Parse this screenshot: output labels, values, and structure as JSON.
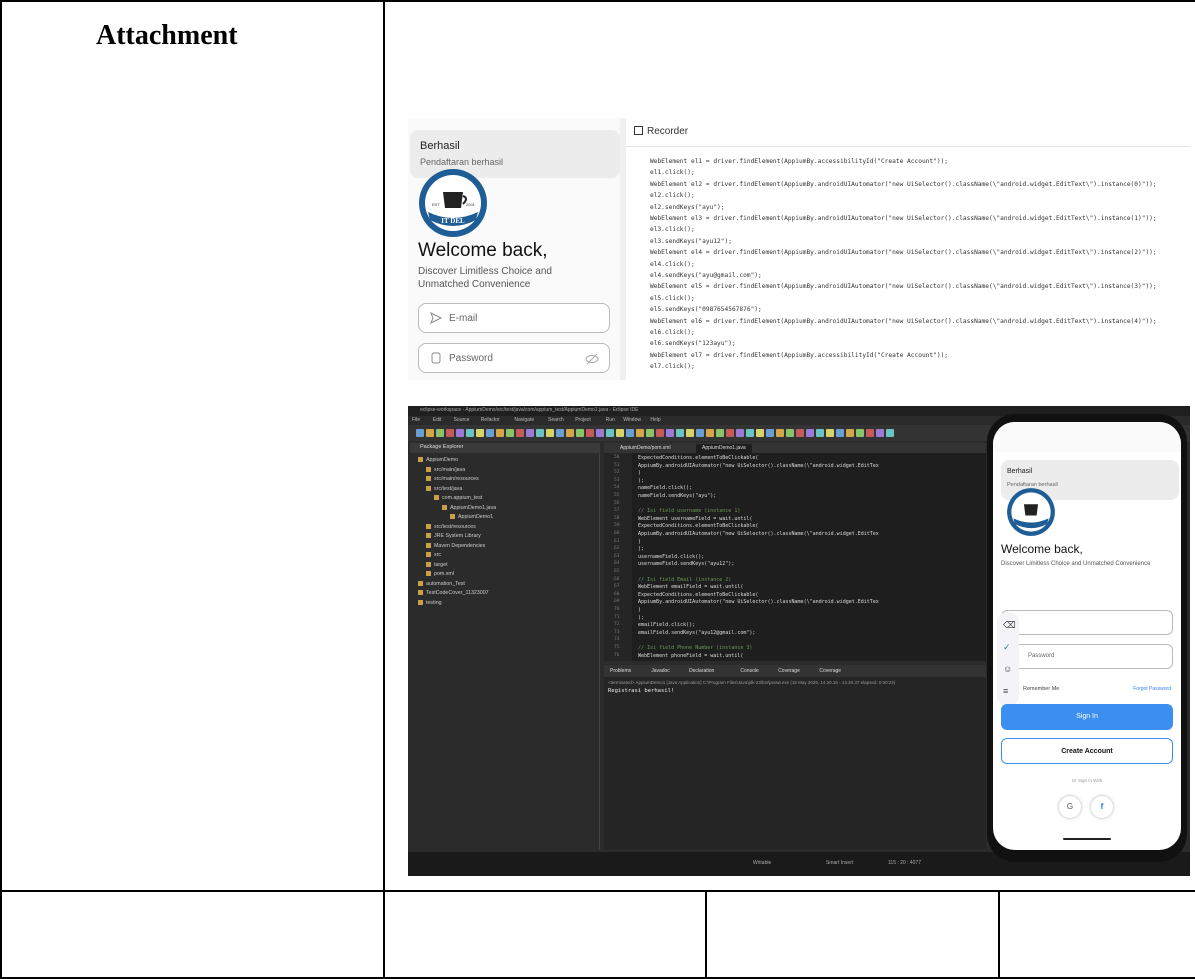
{
  "section": {
    "heading": "Attachment"
  },
  "recorder_shot": {
    "toast": {
      "title": "Berhasil",
      "message": "Pendaftaran berhasil"
    },
    "logo": {
      "left_text": "EST",
      "right_text": "2001",
      "band_text": "IT DEL"
    },
    "welcome": "Welcome back,",
    "subtitle": "Discover Limitless Choice and Unmatched Convenience",
    "email_placeholder": "E-mail",
    "password_placeholder": "Password",
    "recorder_title": "Recorder",
    "code_lines": [
      "WebElement el1 = driver.findElement(AppiumBy.accessibilityId(\"Create Account\"));",
      "el1.click();",
      "WebElement el2 = driver.findElement(AppiumBy.androidUIAutomator(\"new UiSelector().className(\\\"android.widget.EditText\\\").instance(0)\"));",
      "el2.click();",
      "el2.sendKeys(\"ayu\");",
      "WebElement el3 = driver.findElement(AppiumBy.androidUIAutomator(\"new UiSelector().className(\\\"android.widget.EditText\\\").instance(1)\"));",
      "el3.click();",
      "el3.sendKeys(\"ayu12\");",
      "WebElement el4 = driver.findElement(AppiumBy.androidUIAutomator(\"new UiSelector().className(\\\"android.widget.EditText\\\").instance(2)\"));",
      "el4.click();",
      "el4.sendKeys(\"ayu@gmail.com\");",
      "WebElement el5 = driver.findElement(AppiumBy.androidUIAutomator(\"new UiSelector().className(\\\"android.widget.EditText\\\").instance(3)\"));",
      "el5.click();",
      "el5.sendKeys(\"0987654567876\");",
      "WebElement el6 = driver.findElement(AppiumBy.androidUIAutomator(\"new UiSelector().className(\\\"android.widget.EditText\\\").instance(4)\"));",
      "el6.click();",
      "el6.sendKeys(\"123ayu\");",
      "WebElement el7 = driver.findElement(AppiumBy.accessibilityId(\"Create Account\"));",
      "el7.click();"
    ]
  },
  "eclipse_shot": {
    "window_title": "eclipse-workspace - AppiumDemo/src/test/java/com/appium_test/AppiumDemo1.java - Eclipse IDE",
    "menu": [
      "File",
      "Edit",
      "Source",
      "Refactor",
      "Navigate",
      "Search",
      "Project",
      "Run",
      "Window",
      "Help"
    ],
    "package_explorer_title": "Package Explorer",
    "tree": [
      "AppiumDemo",
      "src/main/java",
      "src/main/resources",
      "src/test/java",
      "com.appium_test",
      "AppiumDemo1.java",
      "AppiumDemo1",
      "src/test/resources",
      "JRE System Library",
      "Maven Dependencies",
      "src",
      "target",
      "pom.xml",
      "automation_Test",
      "TestCodeCover_11323007",
      "testing"
    ],
    "editor_tabs": [
      "AppiumDemo/pom.xml",
      "AppiumDemo1.java"
    ],
    "line_numbers": [
      "50",
      "51",
      "52",
      "53",
      "54",
      "55",
      "56",
      "57",
      "58",
      "59",
      "60",
      "61",
      "62",
      "63",
      "64",
      "65",
      "66",
      "67",
      "68",
      "69",
      "70",
      "71",
      "72",
      "73",
      "74",
      "75",
      "76"
    ],
    "code": [
      "ExpectedConditions.elementToBeClickable(",
      "    AppiumBy.androidUIAutomator(\"new UiSelector().className(\\\"android.widget.EditTex",
      ")",
      ");",
      "nameField.click();",
      "nameField.sendKeys(\"ayu\");",
      "",
      "// Isi field username (instance 1)",
      "WebElement usernameField = wait.until(",
      "    ExpectedConditions.elementToBeClickable(",
      "        AppiumBy.androidUIAutomator(\"new UiSelector().className(\\\"android.widget.EditTex",
      "    )",
      ");",
      "usernameField.click();",
      "usernameField.sendKeys(\"ayu12\");",
      "",
      "// Isi field Email (instance 2)",
      "WebElement emailField = wait.until(",
      "    ExpectedConditions.elementToBeClickable(",
      "        AppiumBy.androidUIAutomator(\"new UiSelector().className(\\\"android.widget.EditTex",
      "    )",
      ");",
      "emailField.click();",
      "emailField.sendKeys(\"ayu12@gmail.com\");",
      "",
      "// Isi field Phone Number (instance 3)",
      "WebElement phoneField = wait.until("
    ],
    "console_tabs": [
      "Problems",
      "Javadoc",
      "Declaration",
      "Console",
      "Coverage",
      "Coverage"
    ],
    "console_info": "<terminated> AppiumDemo1 [Java Application] C:\\Program Files\\Java\\jdk-23\\bin\\javaw.exe (15 May 2025, 14.20.15 - 14.20.37 elapsed: 0:00:22)",
    "console_output": "Registrasi berhasil!",
    "status": [
      "Writable",
      "Smart Insert",
      "115 : 20 : 4077"
    ],
    "phone": {
      "toast_title": "Berhasil",
      "toast_message": "Pendaftaran berhasil",
      "welcome": "Welcome back,",
      "subtitle": "Discover Limitless Choice and Unmatched Convenience",
      "password": "Password",
      "remember": "Remember Me",
      "forgot": "Forgot Password",
      "signin": "Sign In",
      "create": "Create Account",
      "or": "Or Sign In With",
      "google": "G"
    }
  }
}
